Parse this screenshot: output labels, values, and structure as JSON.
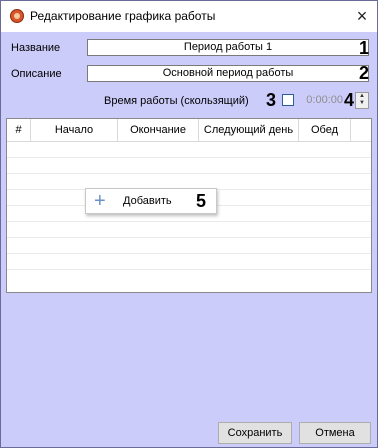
{
  "window": {
    "title": "Редактирование графика работы",
    "close_icon": "×"
  },
  "form": {
    "name_label": "Название",
    "name_value": "Период работы 1",
    "desc_label": "Описание",
    "desc_value": "Основной период работы",
    "time_label": "Время работы (скользящий)",
    "time_value": "0:00:00",
    "time_checked": false
  },
  "markers": [
    "1",
    "2",
    "3",
    "4",
    "5"
  ],
  "table": {
    "columns": [
      "#",
      "Начало",
      "Окончание",
      "Следующий день",
      "Обед"
    ],
    "rows": []
  },
  "context_menu": {
    "add_label": "Добавить",
    "add_icon": "+"
  },
  "buttons": {
    "save": "Сохранить",
    "cancel": "Отмена"
  },
  "spinner": {
    "up": "▲",
    "down": "▼"
  }
}
